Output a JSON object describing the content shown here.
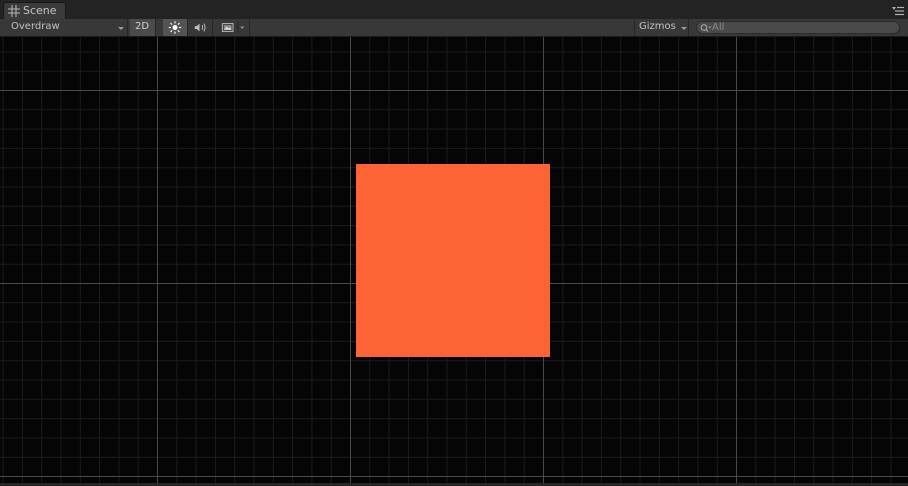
{
  "window": {
    "tab_label": "Scene",
    "tab_icon": "scene-grid-icon",
    "menu_icon": "panel-menu-icon"
  },
  "toolbar": {
    "draw_mode_value": "Overdraw",
    "mode_2d_label": "2D",
    "mode_2d_active": true,
    "lighting_icon": "sun-icon",
    "audio_icon": "audio-icon",
    "effects_icon": "image-effects-icon",
    "gizmos_label": "Gizmos",
    "search_placeholder": "All",
    "search_value": ""
  },
  "scene": {
    "background_color": "#050505",
    "sprite_color": "#fc6434",
    "grid_color": "#4a4a4a"
  }
}
